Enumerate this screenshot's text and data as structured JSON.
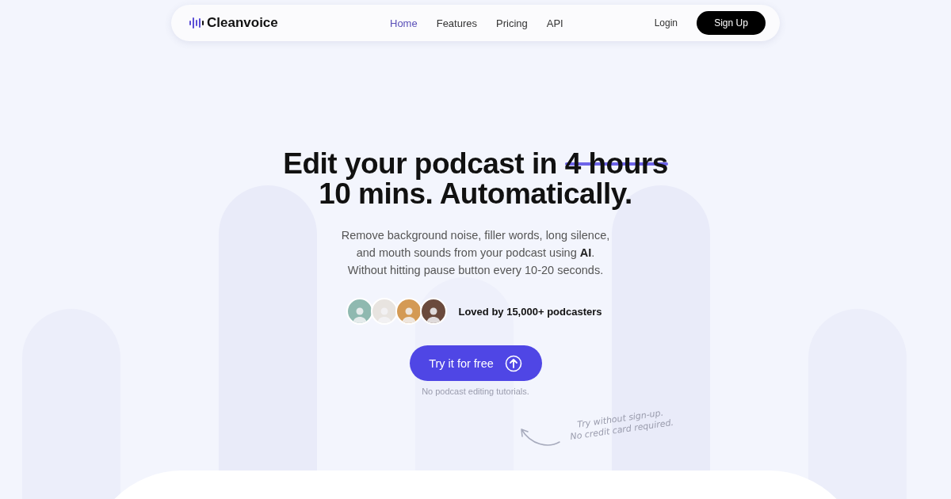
{
  "nav": {
    "brand": "Cleanvoice",
    "links": [
      {
        "label": "Home",
        "selected": true
      },
      {
        "label": "Features",
        "selected": false
      },
      {
        "label": "Pricing",
        "selected": false
      },
      {
        "label": "API",
        "selected": false
      }
    ],
    "login": "Login",
    "signup": "Sign Up"
  },
  "hero": {
    "headline_start": "Edit your podcast in ",
    "headline_struck": "4 hours",
    "headline_end": "10 mins. Automatically.",
    "subtitle": [
      "Remove background noise, filler words, long silence,",
      "and mouth sounds from your podcast using **AI**.",
      "Without hitting pause button every 10-20 seconds."
    ],
    "social_proof": "Loved by 15,000+ podcasters",
    "cta": "Try it for free",
    "cta_note": "No podcast editing tutorials.",
    "side_note": [
      "Try without sign-up.",
      "No credit card required."
    ]
  }
}
